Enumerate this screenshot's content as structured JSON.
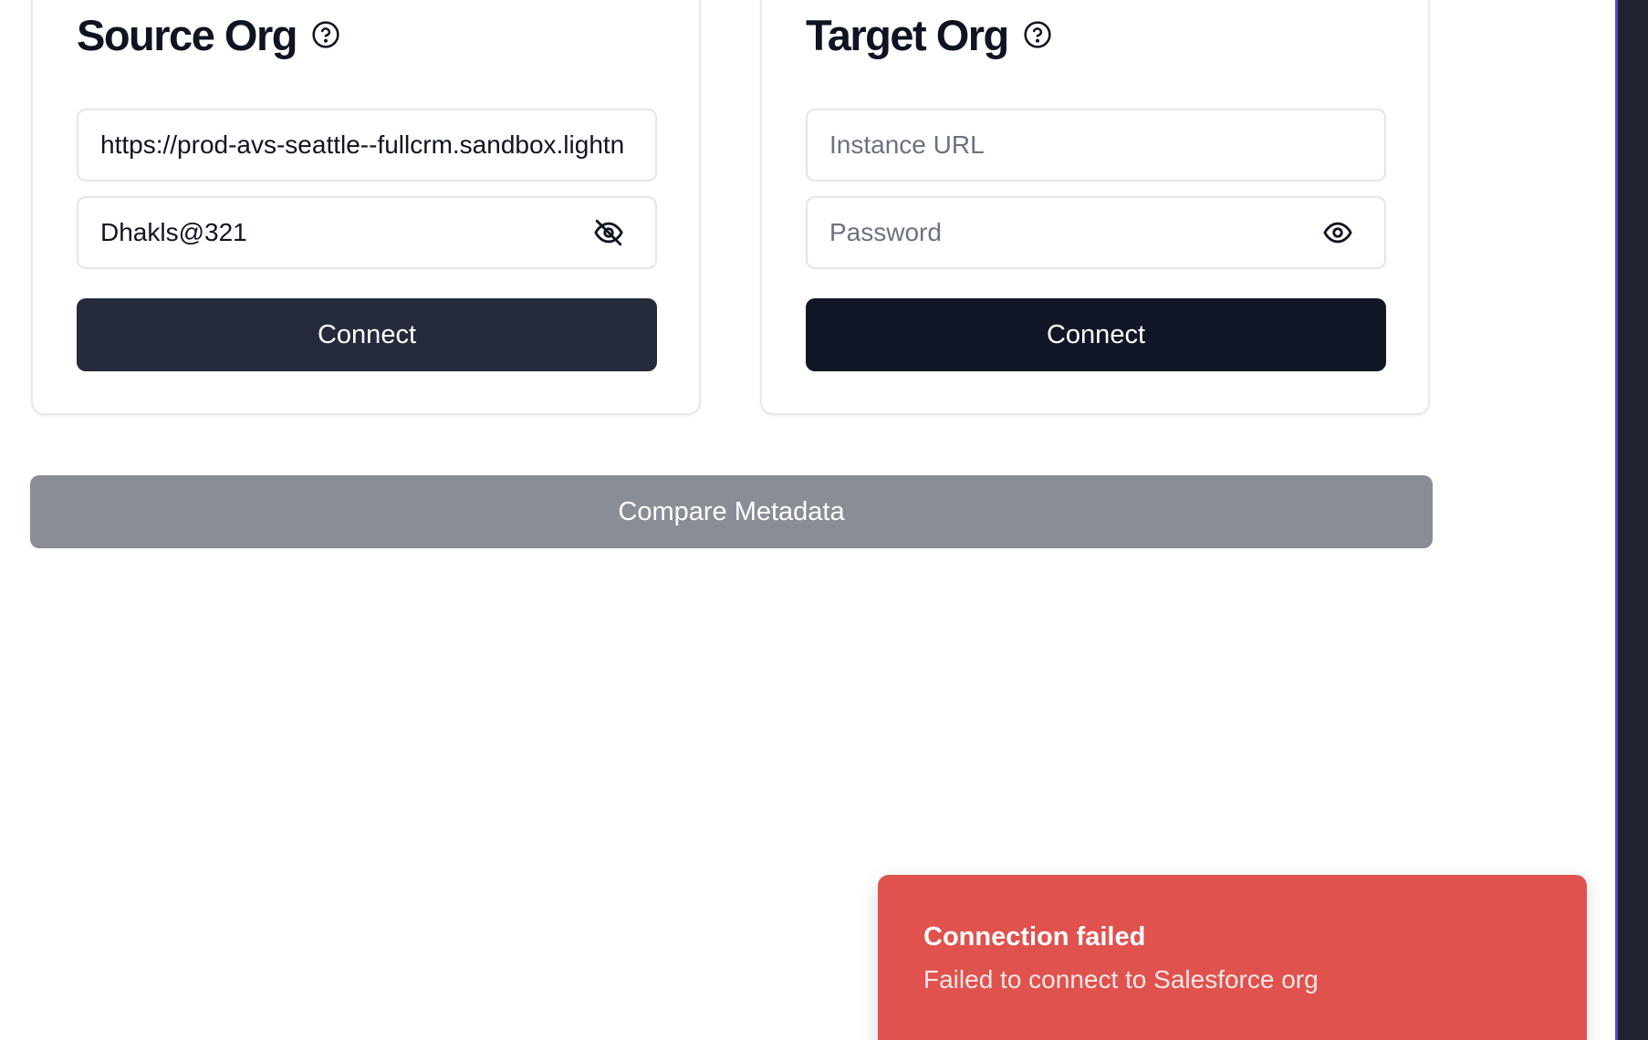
{
  "source_org": {
    "title": "Source Org",
    "help_icon": "question-circle-icon",
    "instance_url": {
      "value": "https://prod-avs-seattle--fullcrm.sandbox.lightning.force.com",
      "placeholder": "Instance URL"
    },
    "password": {
      "value": "Dhakls@321",
      "placeholder": "Password",
      "visibility_icon": "eye-off-icon"
    },
    "connect_label": "Connect",
    "connect_color": "#262b3c"
  },
  "target_org": {
    "title": "Target Org",
    "help_icon": "question-circle-icon",
    "instance_url": {
      "value": "",
      "placeholder": "Instance URL"
    },
    "password": {
      "value": "",
      "placeholder": "Password",
      "visibility_icon": "eye-icon"
    },
    "connect_label": "Connect",
    "connect_color": "#121727"
  },
  "compare": {
    "label": "Compare Metadata",
    "disabled": true,
    "color": "#898d96"
  },
  "toast": {
    "title": "Connection failed",
    "description": "Failed to connect to Salesforce org",
    "color": "#df524e"
  },
  "colors": {
    "accent_rail": "#5b47c7",
    "rail_background": "#1f2330"
  }
}
